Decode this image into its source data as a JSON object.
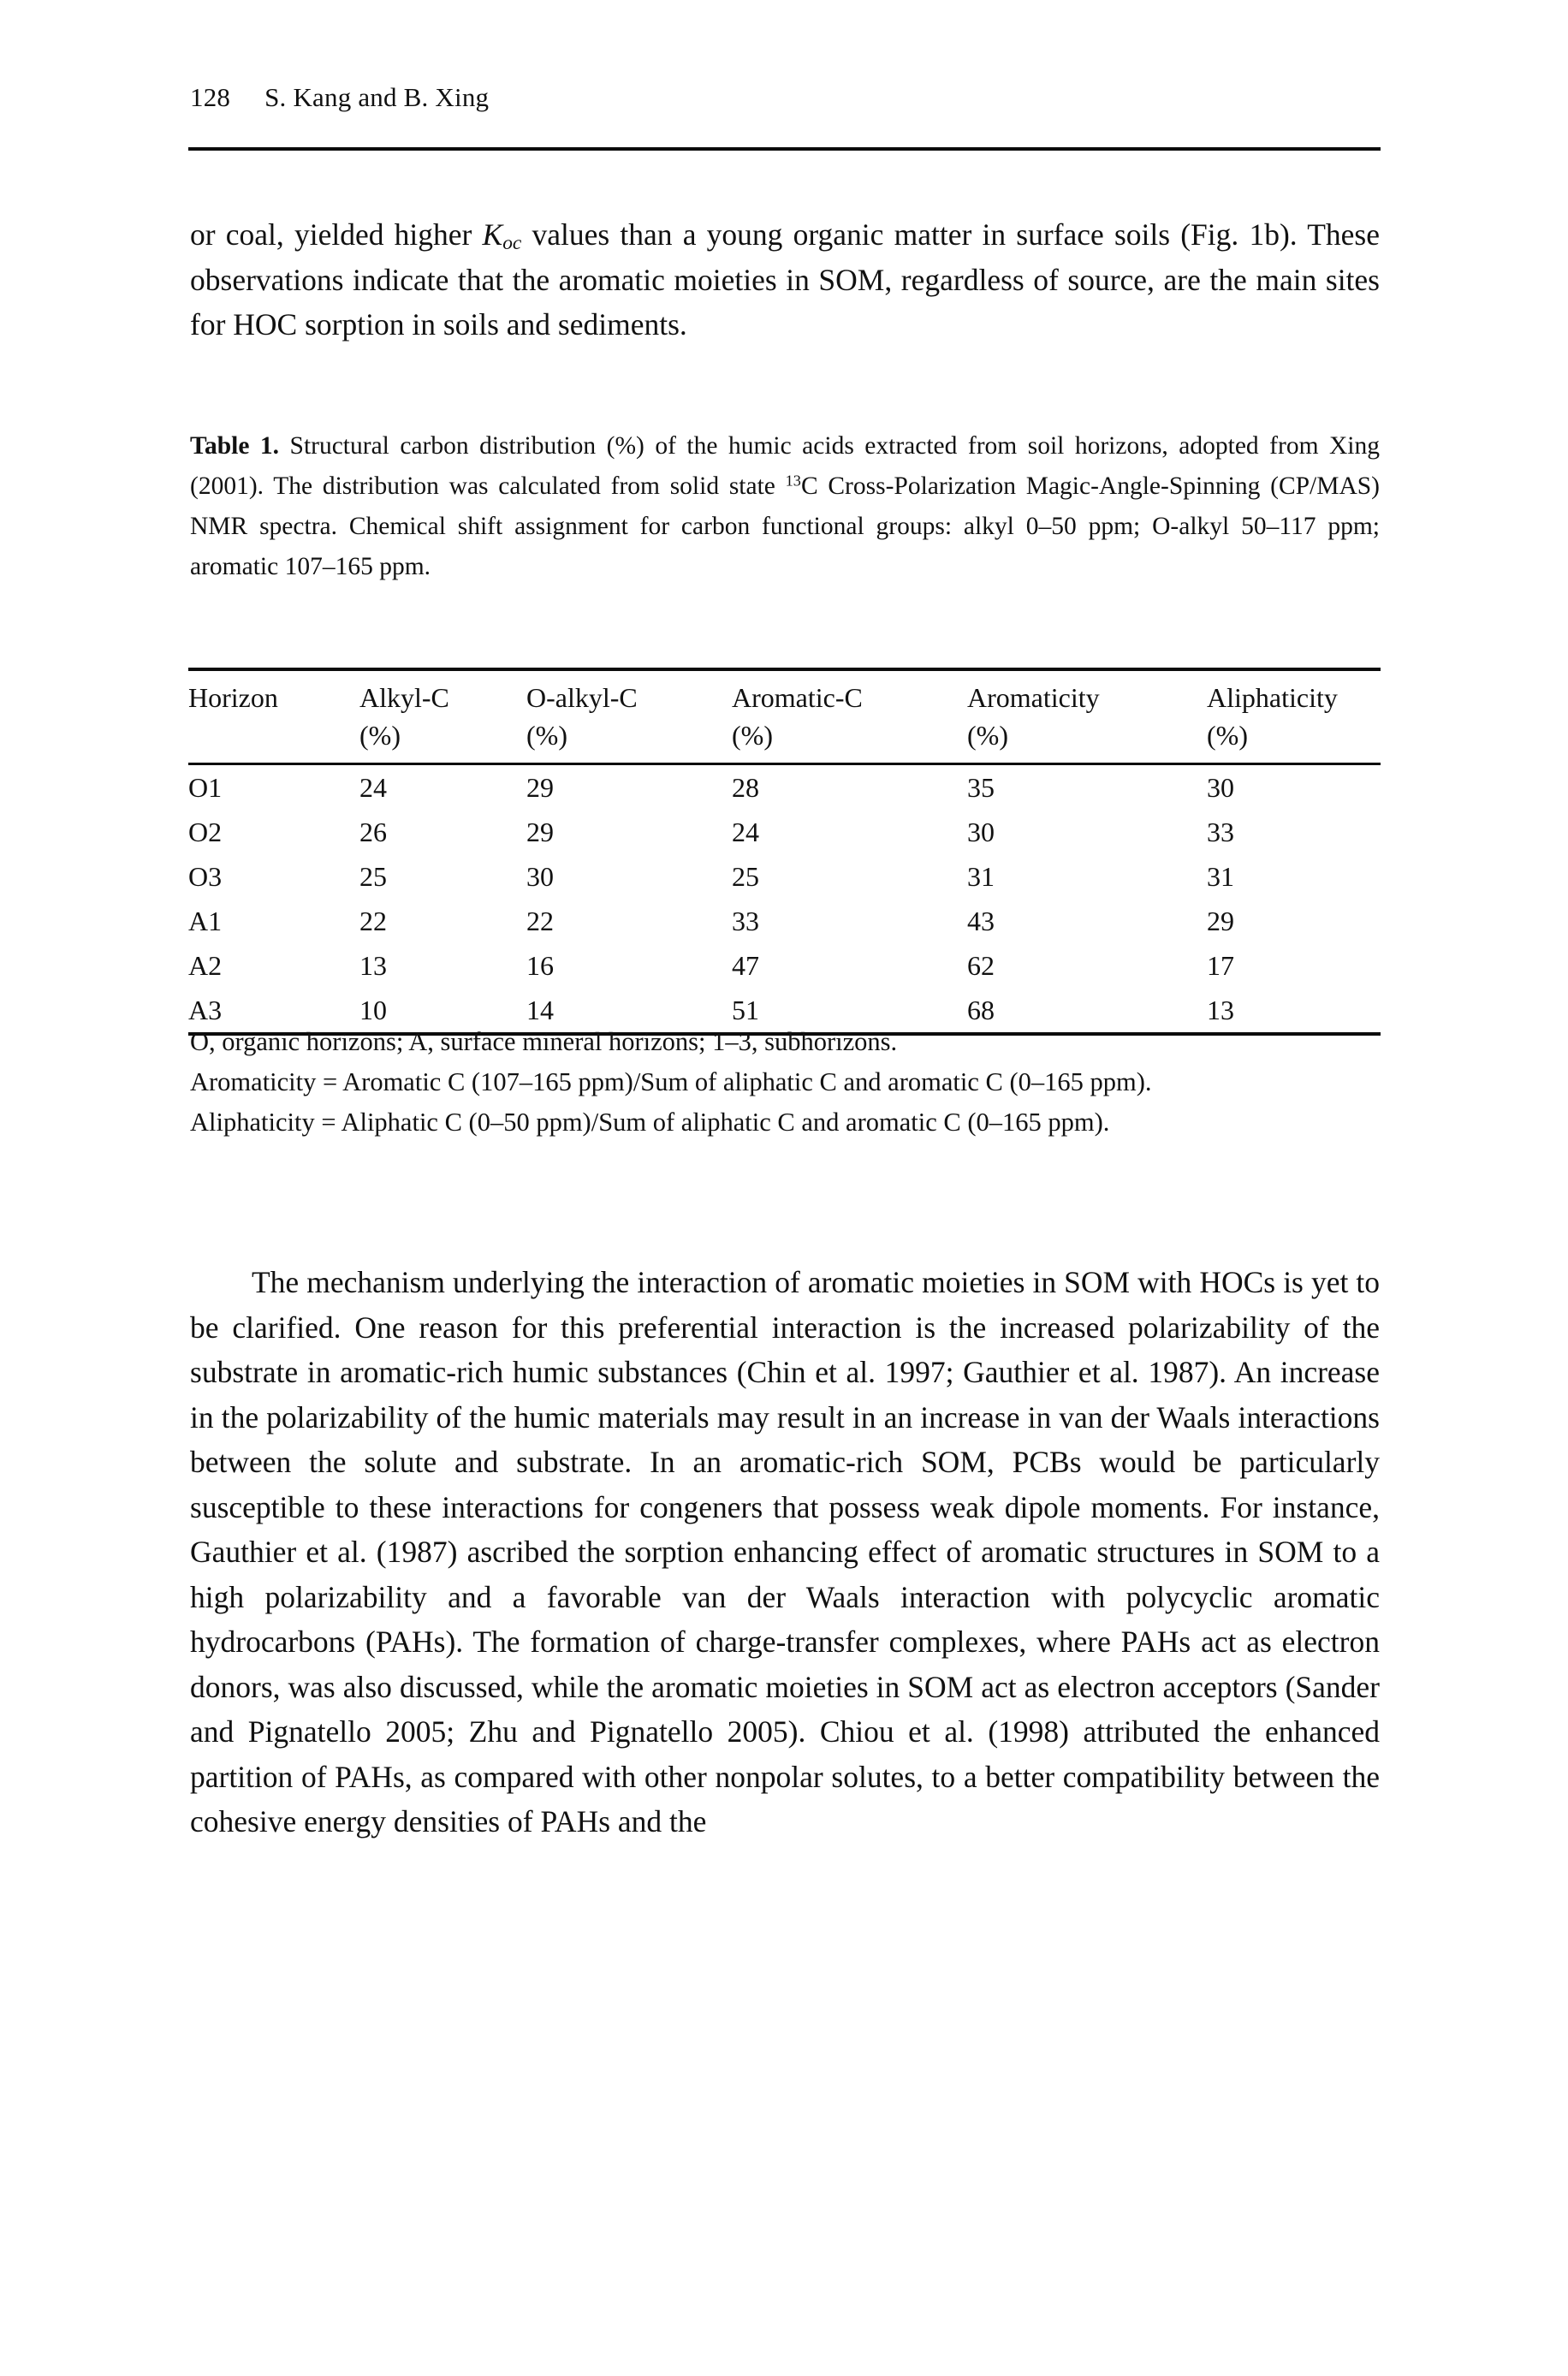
{
  "runhead": {
    "page_number": "128",
    "authors": "S. Kang and B. Xing"
  },
  "intro_paragraph": {
    "seg1": "or coal, yielded higher ",
    "symbol_main": "K",
    "symbol_sub": "oc",
    "seg2": " values than a young organic matter in surface soils (Fig. 1b). These observations indicate that the aromatic moieties in SOM, regardless of source, are the main sites for HOC sorption in soils and sediments."
  },
  "table_caption": {
    "label": "Table 1.",
    "text_before_iso": " Structural carbon distribution (%) of the humic acids extracted from soil horizons, adopted from Xing (2001). The distribution was calculated from solid state ",
    "isotope_sup": "13",
    "isotope_base": "C",
    "text_after_iso": " Cross-Polarization Magic-Angle-Spinning (CP/MAS) NMR spectra. Chemical shift assignment for carbon functional groups: alkyl 0–50 ppm; O-alkyl 50–117 ppm; aromatic 107–165 ppm."
  },
  "table": {
    "columns": [
      {
        "line1": "Horizon",
        "line2": ""
      },
      {
        "line1": "Alkyl-C",
        "line2": "(%)"
      },
      {
        "line1": "O-alkyl-C",
        "line2": "(%)"
      },
      {
        "line1": "Aromatic-C",
        "line2": "(%)"
      },
      {
        "line1": "Aromaticity",
        "line2": "(%)"
      },
      {
        "line1": "Aliphaticity",
        "line2": "(%)"
      }
    ],
    "rows": [
      {
        "horizon": "O1",
        "alkyl_c": "24",
        "o_alkyl_c": "29",
        "aromatic_c": "28",
        "aromaticity": "35",
        "aliphaticity": "30"
      },
      {
        "horizon": "O2",
        "alkyl_c": "26",
        "o_alkyl_c": "29",
        "aromatic_c": "24",
        "aromaticity": "30",
        "aliphaticity": "33"
      },
      {
        "horizon": "O3",
        "alkyl_c": "25",
        "o_alkyl_c": "30",
        "aromatic_c": "25",
        "aromaticity": "31",
        "aliphaticity": "31"
      },
      {
        "horizon": "A1",
        "alkyl_c": "22",
        "o_alkyl_c": "22",
        "aromatic_c": "33",
        "aromaticity": "43",
        "aliphaticity": "29"
      },
      {
        "horizon": "A2",
        "alkyl_c": "13",
        "o_alkyl_c": "16",
        "aromatic_c": "47",
        "aromaticity": "62",
        "aliphaticity": "17"
      },
      {
        "horizon": "A3",
        "alkyl_c": "10",
        "o_alkyl_c": "14",
        "aromatic_c": "51",
        "aromaticity": "68",
        "aliphaticity": "13"
      }
    ]
  },
  "table_notes": {
    "line1": "O, organic horizons; A, surface mineral horizons; 1–3, subhorizons.",
    "line2": "Aromaticity = Aromatic C (107–165 ppm)/Sum of aliphatic C and aromatic C (0–165 ppm).",
    "line3": "Aliphaticity = Aliphatic C (0–50 ppm)/Sum of aliphatic C and aromatic C (0–165 ppm)."
  },
  "main_paragraph": {
    "text": "The mechanism underlying the interaction of aromatic moieties in SOM with HOCs is yet to be clarified. One reason for this preferential interaction is the increased polarizability of the substrate in aromatic-rich humic substances (Chin et al. 1997; Gauthier et al. 1987). An increase in the polarizability of the humic materials may result in an increase in van der Waals interactions between the solute and substrate. In an aromatic-rich SOM, PCBs would be particularly susceptible to these interactions for congeners that possess weak dipole moments. For instance, Gauthier et al. (1987) ascribed the sorption enhancing effect of aromatic structures in SOM to a high polarizability and a favorable van der Waals interaction with polycyclic aromatic hydrocarbons (PAHs). The formation of charge-transfer complexes, where PAHs act as electron donors, was also discussed, while the aromatic moieties in SOM act as electron acceptors (Sander and Pignatello 2005; Zhu and Pignatello 2005). Chiou et al. (1998) attributed the enhanced partition of PAHs, as compared with other nonpolar solutes, to a better compatibility between the cohesive energy densities of PAHs and the"
  },
  "colors": {
    "page_background": "#ffffff",
    "text": "#111111",
    "rule": "#0c0c0c"
  }
}
